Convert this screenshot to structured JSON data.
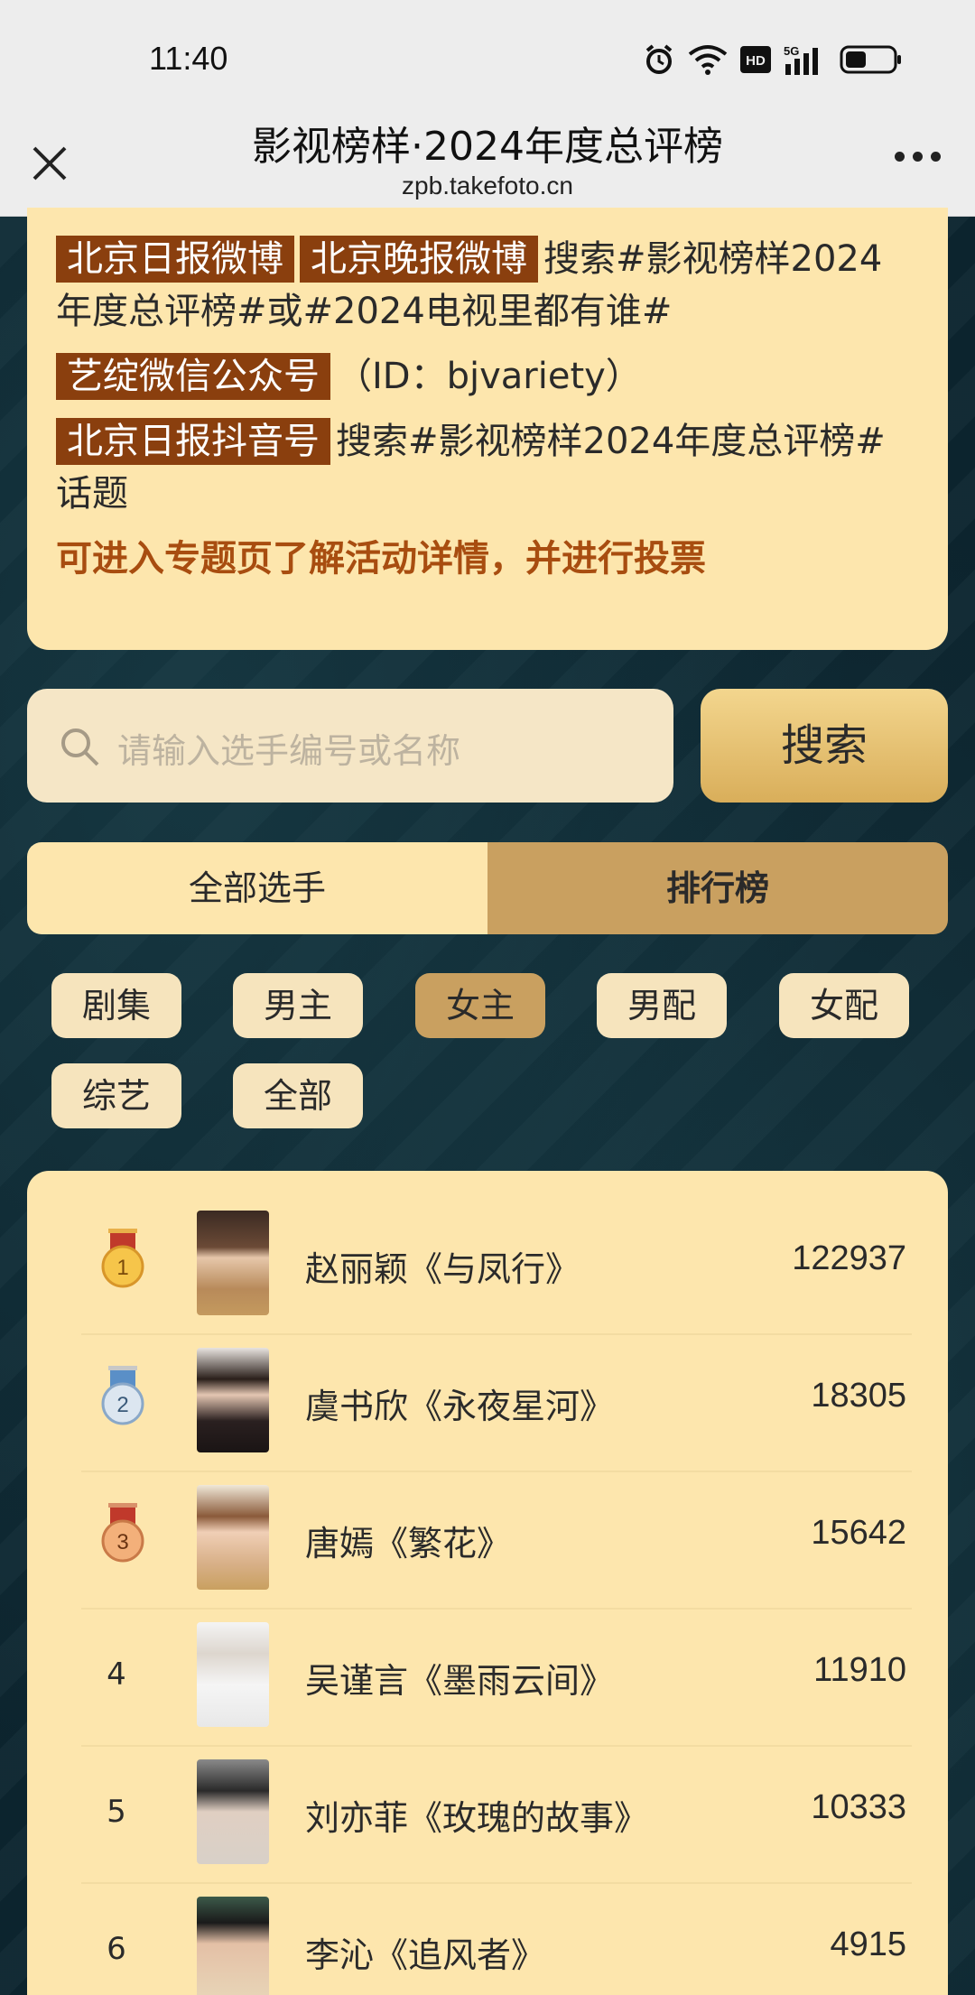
{
  "status_bar": {
    "time": "11:40",
    "icons": [
      "alarm-icon",
      "wifi-icon",
      "hd-icon",
      "signal-5g-icon",
      "battery-icon"
    ]
  },
  "header": {
    "title": "影视榜样·2024年度总评榜",
    "url": "zpb.takefoto.cn"
  },
  "info": {
    "tag_weibo_daily": "北京日报微博",
    "tag_weibo_evening": "北京晚报微博",
    "weibo_text": "搜索#影视榜样2024年度总评榜#或#2024电视里都有谁#",
    "tag_wechat": "艺绽微信公众号",
    "wechat_text": "（ID：bjvariety）",
    "tag_douyin": "北京日报抖音号",
    "douyin_text": "搜索#影视榜样2024年度总评榜#话题",
    "highlight": "可进入专题页了解活动详情，并进行投票"
  },
  "search": {
    "placeholder": "请输入选手编号或名称",
    "button_label": "搜索"
  },
  "tabs": [
    {
      "label": "全部选手",
      "active": false
    },
    {
      "label": "排行榜",
      "active": true
    }
  ],
  "categories": [
    {
      "label": "剧集",
      "active": false
    },
    {
      "label": "男主",
      "active": false
    },
    {
      "label": "女主",
      "active": true
    },
    {
      "label": "男配",
      "active": false
    },
    {
      "label": "女配",
      "active": false
    },
    {
      "label": "综艺",
      "active": false
    },
    {
      "label": "全部",
      "active": false
    }
  ],
  "ranking": [
    {
      "rank": "1",
      "name": "赵丽颖《与凤行》",
      "votes": "122937",
      "medal": "gold"
    },
    {
      "rank": "2",
      "name": "虞书欣《永夜星河》",
      "votes": "18305",
      "medal": "silver"
    },
    {
      "rank": "3",
      "name": "唐嫣《繁花》",
      "votes": "15642",
      "medal": "bronze"
    },
    {
      "rank": "4",
      "name": "吴谨言《墨雨云间》",
      "votes": "11910",
      "medal": ""
    },
    {
      "rank": "5",
      "name": "刘亦菲《玫瑰的故事》",
      "votes": "10333",
      "medal": ""
    },
    {
      "rank": "6",
      "name": "李沁《追风者》",
      "votes": "4915",
      "medal": ""
    }
  ],
  "colors": {
    "card": "#fde6ad",
    "tag": "#8a3f0e",
    "highlight": "#a84d10",
    "active": "#c9a060",
    "background": "#0d2630"
  }
}
